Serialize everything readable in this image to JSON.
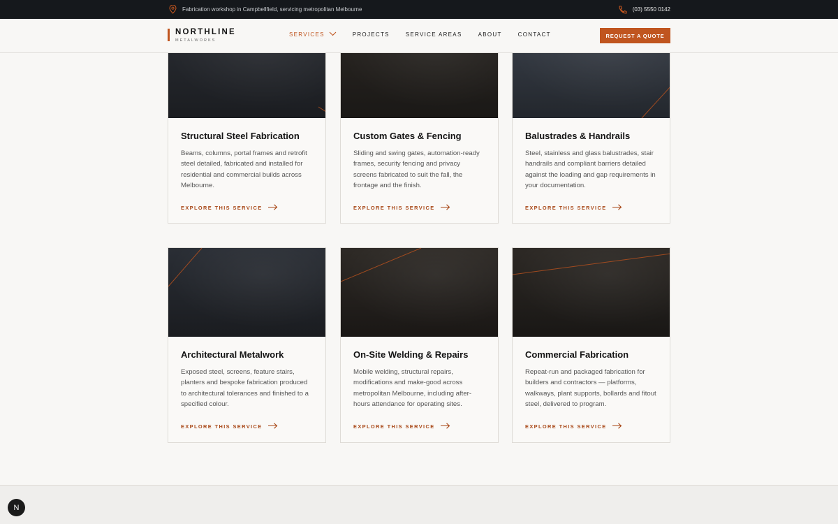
{
  "topbar": {
    "location_text": "Fabrication workshop in Campbellfield, servicing metropolitan Melbourne",
    "location_icon": "map-pin-icon",
    "phone": "(03) 5550 0142",
    "phone_icon": "phone-icon"
  },
  "brand": {
    "name": "NORTHLINE",
    "tagline": "METALWORKS",
    "accent": "#c0551f"
  },
  "nav": {
    "items": [
      {
        "label": "SERVICES",
        "active": true,
        "dropdown": true
      },
      {
        "label": "PROJECTS"
      },
      {
        "label": "SERVICE AREAS"
      },
      {
        "label": "ABOUT"
      },
      {
        "label": "CONTACT"
      }
    ],
    "cta": "REQUEST A QUOTE"
  },
  "cards": [
    {
      "title": "Structural Steel Fabrication",
      "desc": "Beams, columns, portal frames and retrofit steel detailed, fabricated and installed for residential and commercial builds across Melbourne.",
      "link": "EXPLORE THIS SERVICE"
    },
    {
      "title": "Custom Gates & Fencing",
      "desc": "Sliding and swing gates, automation-ready frames, security fencing and privacy screens fabricated to suit the fall, the frontage and the finish.",
      "link": "EXPLORE THIS SERVICE"
    },
    {
      "title": "Balustrades & Handrails",
      "desc": "Steel, stainless and glass balustrades, stair handrails and compliant barriers detailed against the loading and gap requirements in your documentation.",
      "link": "EXPLORE THIS SERVICE"
    },
    {
      "title": "Architectural Metalwork",
      "desc": "Exposed steel, screens, feature stairs, planters and bespoke fabrication produced to architectural tolerances and finished to a specified colour.",
      "link": "EXPLORE THIS SERVICE"
    },
    {
      "title": "On-Site Welding & Repairs",
      "desc": "Mobile welding, structural repairs, modifications and make-good across metropolitan Melbourne, including after-hours attendance for operating sites.",
      "link": "EXPLORE THIS SERVICE"
    },
    {
      "title": "Commercial Fabrication",
      "desc": "Repeat-run and packaged fabrication for builders and contractors — platforms, walkways, plant supports, bollards and fitout steel, delivered to program.",
      "link": "EXPLORE THIS SERVICE"
    }
  ],
  "badge": {
    "letter": "N"
  }
}
